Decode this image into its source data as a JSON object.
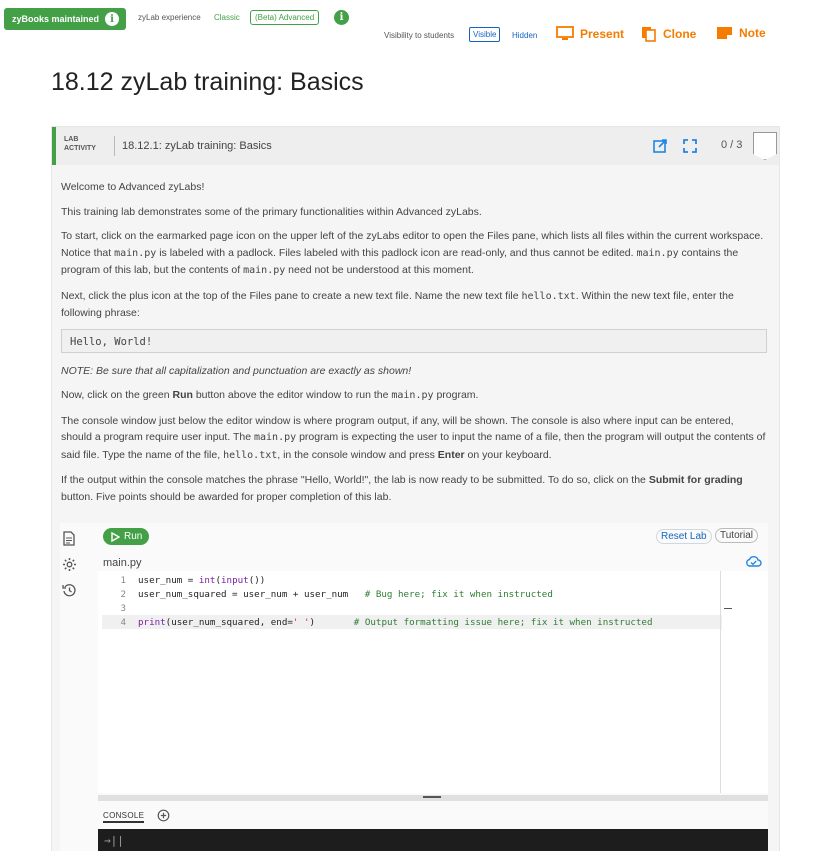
{
  "topbar": {
    "maintained_label": "zyBooks maintained",
    "experience_label": "zyLab experience",
    "classic_label": "Classic",
    "advanced_label": "(Beta) Advanced",
    "visibility_label": "Visibility to students",
    "visible_label": "Visible",
    "hidden_label": "Hidden",
    "present_label": "Present",
    "clone_label": "Clone",
    "note_label": "Note"
  },
  "page": {
    "title": "18.12 zyLab training: Basics"
  },
  "activity": {
    "tag_line1": "LAB",
    "tag_line2": "ACTIVITY",
    "name": "18.12.1: zyLab training: Basics",
    "score": "0 / 3"
  },
  "instructions": {
    "p1": "Welcome to Advanced zyLabs!",
    "p2": "This training lab demonstrates some of the primary functionalities within Advanced zyLabs.",
    "p3_a": "To start, click on the earmarked page icon on the upper left of the zyLabs editor to open the Files pane, which lists all files within the current workspace. Notice that ",
    "p3_code1": "main.py",
    "p3_b": " is labeled with a padlock. Files labeled with this padlock icon are read-only, and thus cannot be edited. ",
    "p3_code2": "main.py",
    "p3_c": " contains the program of this lab, but the contents of ",
    "p3_code3": "main.py",
    "p3_d": " need not be understood at this moment.",
    "p4_a": "Next, click the plus icon at the top of the Files pane to create a new text file. Name the new text file ",
    "p4_code": "hello.txt",
    "p4_b": ". Within the new text file, enter the following phrase:",
    "phrase": "Hello, World!",
    "note": "NOTE: Be sure that all capitalization and punctuation are exactly as shown!",
    "p5_a": "Now, click on the green ",
    "p5_bold": "Run",
    "p5_b": " button above the editor window to run the ",
    "p5_code": "main.py",
    "p5_c": " program.",
    "p6_a": "The console window just below the editor window is where program output, if any, will be shown. The console is also where input can be entered, should a program require user input. The ",
    "p6_code1": "main.py",
    "p6_b": " program is expecting the user to input the name of a file, then the program will output the contents of said file. Type the name of the file, ",
    "p6_code2": "hello.txt",
    "p6_c": ", in the console window and press ",
    "p6_bold": "Enter",
    "p6_d": " on your keyboard.",
    "p7_a": "If the output within the console matches the phrase \"Hello, World!\", the lab is now ready to be submitted. To do so, click on the ",
    "p7_bold1": "Submit for grading",
    "p7_b": " button. Five points should be awarded for proper completion of this lab."
  },
  "editor": {
    "run_label": "Run",
    "reset_label": "Reset Lab",
    "tutorial_label": "Tutorial",
    "file_name": "main.py",
    "console_label": "CONSOLE",
    "console_prompt": "→||",
    "lines": [
      {
        "n": "1",
        "a": "user_num = ",
        "kw": "int",
        "b": "(",
        "kw2": "input",
        "c": "())",
        "cmt": ""
      },
      {
        "n": "2",
        "a": "user_num_squared = user_num + user_num   ",
        "cmt": "# Bug here; fix it when instructed"
      },
      {
        "n": "3",
        "a": ""
      },
      {
        "n": "4",
        "kw": "print",
        "a": "(user_num_squared, end=",
        "str": "' '",
        "b": ")       ",
        "cmt": "# Output formatting issue here; fix it when instructed"
      }
    ]
  }
}
